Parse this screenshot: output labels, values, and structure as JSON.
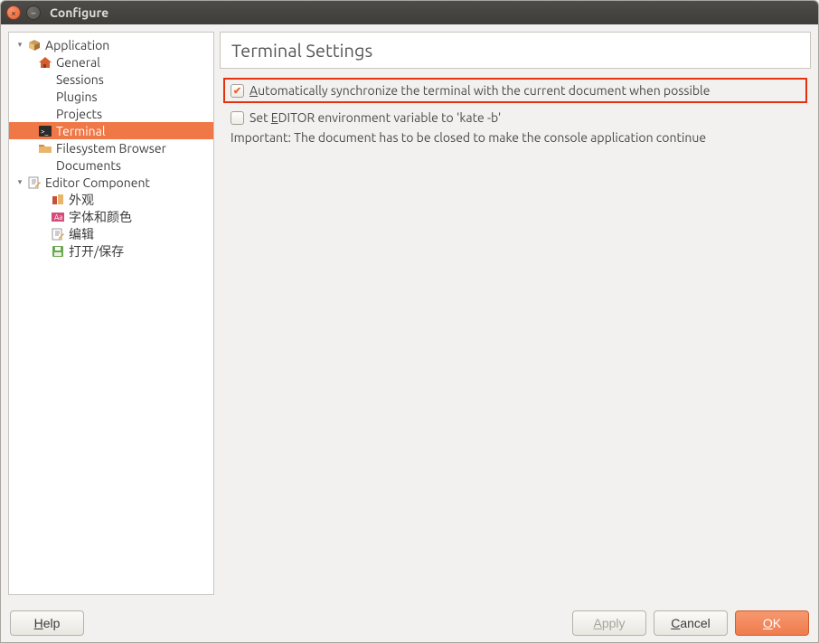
{
  "window": {
    "title": "Configure"
  },
  "tree": {
    "application": {
      "label": "Application",
      "general": "General",
      "sessions": "Sessions",
      "plugins": "Plugins",
      "projects": "Projects",
      "terminal": "Terminal",
      "filesystem_browser": "Filesystem Browser",
      "documents": "Documents"
    },
    "editor_component": {
      "label": "Editor Component",
      "appearance": "外观",
      "fonts_colors": "字体和颜色",
      "editing": "编辑",
      "open_save": "打开/保存"
    }
  },
  "panel": {
    "title": "Terminal Settings",
    "auto_sync": {
      "checked": true,
      "mn": "A",
      "rest": "utomatically synchronize the terminal with the current document when possible"
    },
    "set_editor": {
      "checked": false,
      "pre": "Set ",
      "mn": "E",
      "rest": "DITOR environment variable to 'kate -b'"
    },
    "note": "Important: The document has to be closed to make the console application continue"
  },
  "footer": {
    "help_mn": "H",
    "help_rest": "elp",
    "apply_mn": "A",
    "apply_rest": "pply",
    "cancel_mn": "C",
    "cancel_rest": "ancel",
    "ok_mn": "O",
    "ok_rest": "K"
  }
}
